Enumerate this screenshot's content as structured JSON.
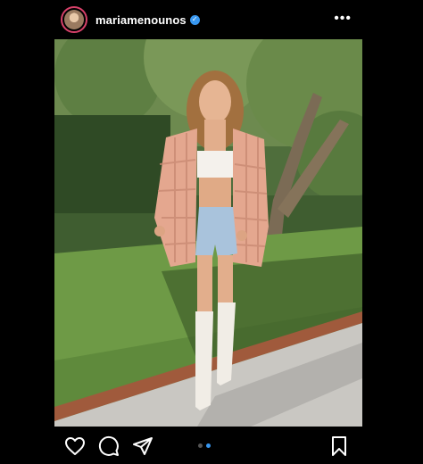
{
  "post": {
    "username": "mariamenounos",
    "verified": true,
    "carousel": {
      "count": 2,
      "active_index": 2
    }
  },
  "icons": {
    "more": "more-options-icon",
    "like": "heart-icon",
    "comment": "comment-icon",
    "share": "send-icon",
    "save": "bookmark-icon"
  },
  "colors": {
    "background": "#000000",
    "accent": "#3897f0",
    "story_ring": "#d8416a"
  }
}
